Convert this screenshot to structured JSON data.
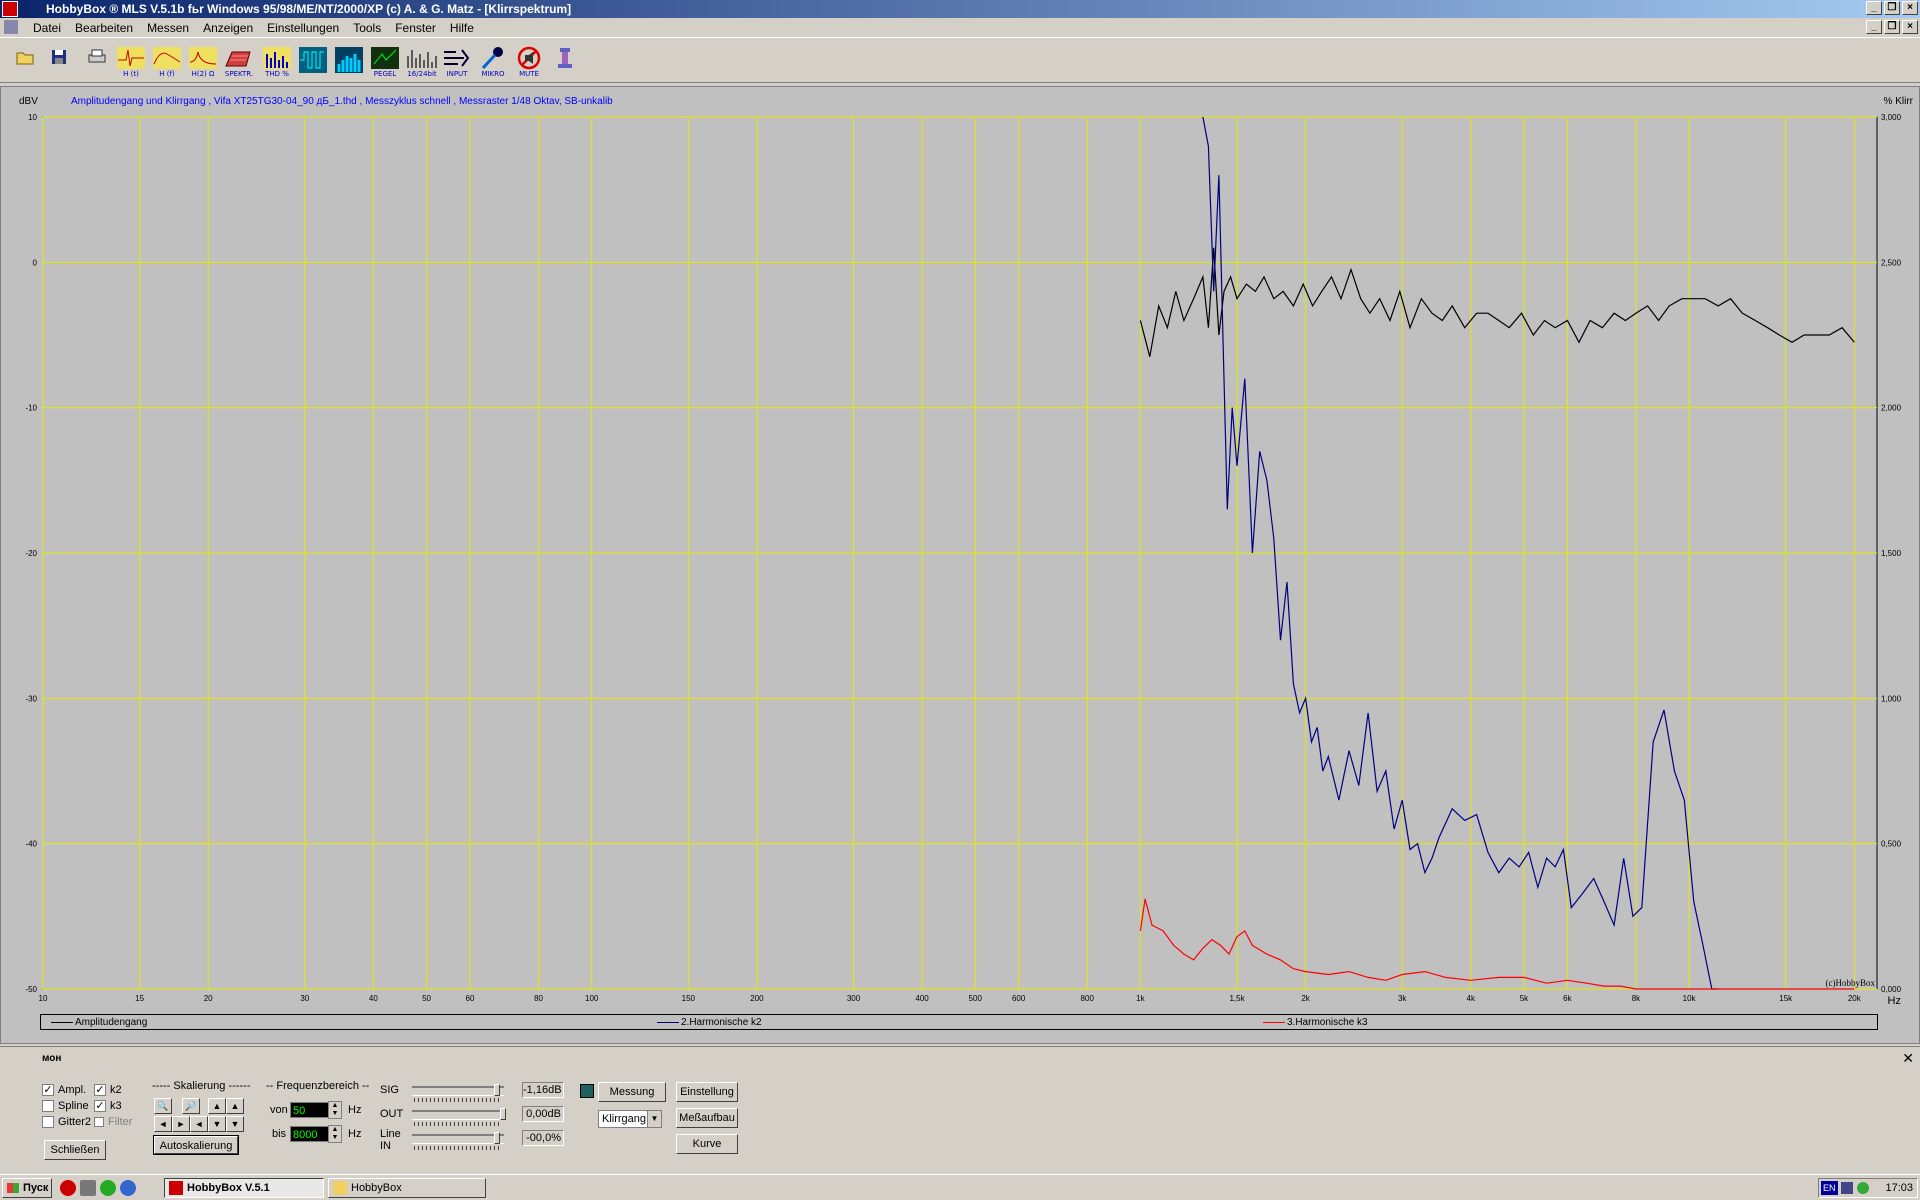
{
  "window": {
    "title": "HobbyBox ® MLS  V.5.1b   fьr Windows 95/98/ME/NT/2000/XP    (c)  A. & G. Matz - [Klirrspektrum]"
  },
  "menu": [
    "Datei",
    "Bearbeiten",
    "Messen",
    "Anzeigen",
    "Einstellungen",
    "Tools",
    "Fenster",
    "Hilfe"
  ],
  "toolbar": {
    "buttons": [
      {
        "icon": "open-folder-icon",
        "label": ""
      },
      {
        "icon": "save-disk-icon",
        "label": ""
      },
      {
        "icon": "printer-icon",
        "label": ""
      },
      {
        "icon": "impulse-response-icon",
        "label": "H (t)"
      },
      {
        "icon": "frequency-response-icon",
        "label": "H (f)"
      },
      {
        "icon": "impedance-icon",
        "label": "H(2) Ω"
      },
      {
        "icon": "spectrum-3d-icon",
        "label": "SPEKTR."
      },
      {
        "icon": "thd-bars-icon",
        "label": "THD %"
      },
      {
        "icon": "oscilloscope-icon",
        "label": ""
      },
      {
        "icon": "rta-bars-icon",
        "label": ""
      },
      {
        "icon": "level-meter-icon",
        "label": "PEGEL"
      },
      {
        "icon": "bit-spectrum-icon",
        "label": "16/24bit"
      },
      {
        "icon": "input-mixer-icon",
        "label": "INPUT"
      },
      {
        "icon": "microphone-icon",
        "label": "MIKRO"
      },
      {
        "icon": "mute-icon",
        "label": "MUTE"
      },
      {
        "icon": "exit-icon",
        "label": ""
      }
    ]
  },
  "chart_data": {
    "type": "line",
    "title": "Amplitudengang und Klirrgang , Vifa XT25TG30-04_90 дБ_1.thd , Messzyklus schnell , Messraster 1/48 Oktav, SB-unkalib",
    "ylabel": "dBV",
    "y2label": "% Klirr",
    "xlabel": "Hz",
    "xscale": "log",
    "xlim": [
      10,
      22000
    ],
    "ylim": [
      -50,
      10
    ],
    "y2lim": [
      0,
      3
    ],
    "grid": true,
    "y_ticks": [
      "10",
      "0",
      "-10",
      "-20",
      "-30",
      "-40",
      "-50"
    ],
    "y2_ticks": [
      "3,000",
      "2,500",
      "2,000",
      "1,500",
      "1,000",
      "0,500",
      "0,000"
    ],
    "x_ticks": [
      {
        "v": 10,
        "l": "10"
      },
      {
        "v": 15,
        "l": "15"
      },
      {
        "v": 20,
        "l": "20"
      },
      {
        "v": 30,
        "l": "30"
      },
      {
        "v": 40,
        "l": "40"
      },
      {
        "v": 50,
        "l": "50"
      },
      {
        "v": 60,
        "l": "60"
      },
      {
        "v": 80,
        "l": "80"
      },
      {
        "v": 100,
        "l": "100"
      },
      {
        "v": 150,
        "l": "150"
      },
      {
        "v": 200,
        "l": "200"
      },
      {
        "v": 300,
        "l": "300"
      },
      {
        "v": 400,
        "l": "400"
      },
      {
        "v": 500,
        "l": "500"
      },
      {
        "v": 600,
        "l": "600"
      },
      {
        "v": 800,
        "l": "800"
      },
      {
        "v": 1000,
        "l": "1k"
      },
      {
        "v": 1500,
        "l": "1,5k"
      },
      {
        "v": 2000,
        "l": "2k"
      },
      {
        "v": 3000,
        "l": "3k"
      },
      {
        "v": 4000,
        "l": "4k"
      },
      {
        "v": 5000,
        "l": "5k"
      },
      {
        "v": 6000,
        "l": "6k"
      },
      {
        "v": 8000,
        "l": "8k"
      },
      {
        "v": 10000,
        "l": "10k"
      },
      {
        "v": 15000,
        "l": "15k"
      },
      {
        "v": 20000,
        "l": "20k"
      }
    ],
    "watermark": "(c)HobbyBox",
    "series": [
      {
        "name": "Amplitudengang",
        "axis": "left",
        "color": "#000000",
        "x": [
          1000,
          1040,
          1080,
          1120,
          1160,
          1200,
          1250,
          1300,
          1330,
          1360,
          1390,
          1420,
          1460,
          1500,
          1560,
          1620,
          1680,
          1750,
          1820,
          1900,
          1980,
          2060,
          2140,
          2230,
          2320,
          2420,
          2520,
          2620,
          2730,
          2850,
          2970,
          3100,
          3250,
          3400,
          3550,
          3700,
          3900,
          4100,
          4300,
          4500,
          4700,
          4950,
          5200,
          5450,
          5700,
          6000,
          6300,
          6600,
          6950,
          7300,
          7650,
          8000,
          8400,
          8800,
          9200,
          9700,
          10200,
          10700,
          11300,
          11900,
          12500,
          13200,
          13900,
          14600,
          15400,
          16200,
          17000,
          18000,
          19000,
          20000
        ],
        "y": [
          -4,
          -6.5,
          -3,
          -4.5,
          -2,
          -4,
          -2.5,
          -1,
          -4.5,
          1,
          -5,
          -2,
          -1,
          -2.5,
          -1.5,
          -2,
          -1,
          -2.5,
          -2,
          -3,
          -1.5,
          -3,
          -2,
          -1,
          -2.5,
          -0.5,
          -2.5,
          -3.5,
          -2.5,
          -4,
          -2,
          -4.5,
          -2.5,
          -3.5,
          -4,
          -3,
          -4.5,
          -3.5,
          -3.5,
          -4,
          -4.5,
          -3.5,
          -5,
          -4,
          -4.5,
          -4,
          -5.5,
          -4,
          -4.5,
          -3.5,
          -4,
          -3.5,
          -3,
          -4,
          -3,
          -2.5,
          -2.5,
          -2.5,
          -3,
          -2.5,
          -3.5,
          -4,
          -4.5,
          -5,
          -5.5,
          -5,
          -5,
          -5,
          -4.5,
          -5.5
        ]
      },
      {
        "name": "2.Harmonische k2",
        "axis": "right",
        "color": "#000080",
        "x": [
          1300,
          1330,
          1360,
          1390,
          1420,
          1440,
          1470,
          1500,
          1550,
          1600,
          1650,
          1700,
          1750,
          1800,
          1850,
          1900,
          1950,
          2000,
          2050,
          2100,
          2150,
          2200,
          2300,
          2400,
          2500,
          2600,
          2700,
          2800,
          2900,
          3000,
          3100,
          3200,
          3300,
          3400,
          3500,
          3700,
          3900,
          4100,
          4300,
          4500,
          4700,
          4900,
          5100,
          5300,
          5500,
          5700,
          5900,
          6100,
          6400,
          6700,
          7000,
          7300,
          7600,
          7900,
          8200,
          8600,
          9000,
          9400,
          9800,
          10200,
          10600,
          11000,
          11300
        ],
        "y": [
          3.0,
          2.9,
          2.4,
          2.8,
          2.1,
          1.65,
          2.0,
          1.8,
          2.1,
          1.5,
          1.85,
          1.75,
          1.55,
          1.2,
          1.4,
          1.05,
          0.95,
          1.0,
          0.85,
          0.9,
          0.75,
          0.8,
          0.65,
          0.82,
          0.7,
          0.95,
          0.68,
          0.75,
          0.55,
          0.65,
          0.48,
          0.5,
          0.4,
          0.45,
          0.52,
          0.62,
          0.58,
          0.6,
          0.47,
          0.4,
          0.45,
          0.42,
          0.47,
          0.35,
          0.45,
          0.42,
          0.48,
          0.28,
          0.33,
          0.38,
          0.3,
          0.22,
          0.45,
          0.25,
          0.28,
          0.85,
          0.96,
          0.75,
          0.65,
          0.3,
          0.15,
          0.0,
          0.0
        ]
      },
      {
        "name": "3.Harmonische k3",
        "axis": "right",
        "color": "#ff0000",
        "x": [
          1000,
          1020,
          1050,
          1100,
          1150,
          1200,
          1250,
          1300,
          1350,
          1400,
          1450,
          1500,
          1550,
          1600,
          1700,
          1800,
          1900,
          2000,
          2200,
          2400,
          2600,
          2800,
          3000,
          3300,
          3600,
          4000,
          4500,
          5000,
          5500,
          6000,
          6500,
          7000,
          7500,
          8000,
          9000,
          10000,
          12000,
          15000,
          18000,
          20000
        ],
        "y": [
          0.2,
          0.31,
          0.22,
          0.2,
          0.15,
          0.12,
          0.1,
          0.14,
          0.17,
          0.15,
          0.12,
          0.18,
          0.2,
          0.15,
          0.12,
          0.1,
          0.07,
          0.06,
          0.05,
          0.06,
          0.04,
          0.03,
          0.05,
          0.06,
          0.04,
          0.03,
          0.04,
          0.04,
          0.02,
          0.03,
          0.02,
          0.01,
          0.01,
          0.0,
          0.0,
          0.0,
          0.0,
          0.0,
          0.0,
          0.0
        ]
      }
    ]
  },
  "legend": [
    "Amplitudengang",
    "2.Harmonische k2",
    "3.Harmonische k3"
  ],
  "panel": {
    "title": "мон",
    "checkboxes": {
      "ampl": {
        "label": "Ampl.",
        "checked": true
      },
      "k2": {
        "label": "k2",
        "checked": true
      },
      "spline": {
        "label": "Spline",
        "checked": false
      },
      "k3": {
        "label": "k3",
        "checked": true
      },
      "gitter2": {
        "label": "Gitter2",
        "checked": false
      },
      "filter": {
        "label": "Filter",
        "checked": false
      }
    },
    "close_label": "Schließen",
    "scale_group": "----- Skalierung ------",
    "auto_scale_label": "Autoskalierung",
    "freq_group": "-- Frequenzbereich --",
    "von_label": "von",
    "von_value": "50",
    "bis_label": "bis",
    "bis_value": "8000",
    "hz": "Hz",
    "sig_label": "SIG",
    "sig_value": "-1,16dB",
    "out_label": "OUT",
    "out_value": "0,00dB",
    "line_label": "Line",
    "in_label": "IN",
    "in_value": "-00,0%",
    "messung_label": "Messung",
    "mode_value": "Klirrgang",
    "einstellung_label": "Einstellung",
    "messaufbau_label": "Meßaufbau",
    "kurve_label": "Kurve"
  },
  "taskbar": {
    "start_label": "Пуск",
    "tasks": [
      "HobbyBox V.5.1",
      "HobbyBox"
    ],
    "lang": "EN",
    "time": "17:03"
  }
}
